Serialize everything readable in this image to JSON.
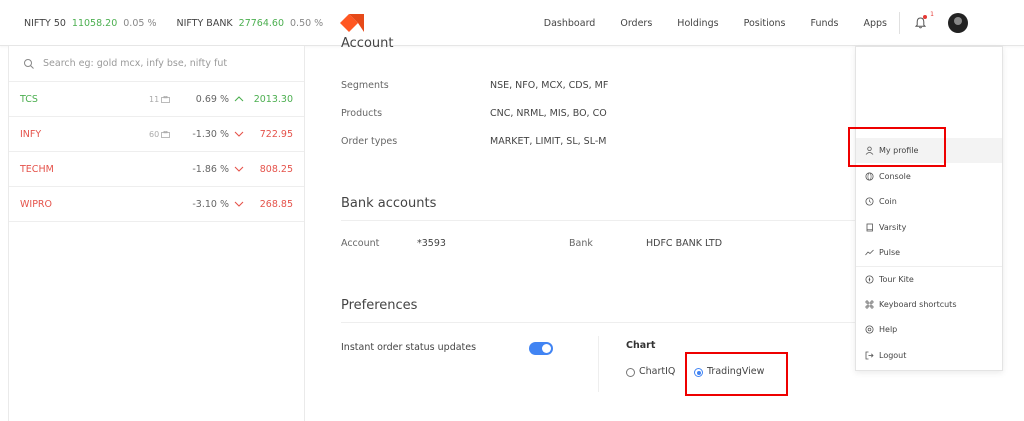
{
  "header": {
    "indices": [
      {
        "name": "NIFTY 50",
        "value": "11058.20",
        "change": "0.05 %"
      },
      {
        "name": "NIFTY BANK",
        "value": "27764.60",
        "change": "0.50 %"
      }
    ],
    "nav": [
      "Dashboard",
      "Orders",
      "Holdings",
      "Positions",
      "Funds",
      "Apps"
    ],
    "notification_count": "1",
    "accent": "#ff5722"
  },
  "sidebar": {
    "search_placeholder": "Search eg: gold mcx, infy bse, nifty fut",
    "watchlist": [
      {
        "symbol": "TCS",
        "qty": "11",
        "change": "0.69 %",
        "price": "2013.30",
        "dir": "up"
      },
      {
        "symbol": "INFY",
        "qty": "60",
        "change": "-1.30 %",
        "price": "722.95",
        "dir": "down"
      },
      {
        "symbol": "TECHM",
        "qty": "",
        "change": "-1.86 %",
        "price": "808.25",
        "dir": "down"
      },
      {
        "symbol": "WIPRO",
        "qty": "",
        "change": "-3.10 %",
        "price": "268.85",
        "dir": "down"
      }
    ]
  },
  "account": {
    "title": "Account",
    "segments_label": "Segments",
    "segments_value": "NSE, NFO, MCX, CDS, MF",
    "products_label": "Products",
    "products_value": "CNC, NRML, MIS, BO, CO",
    "order_types_label": "Order types",
    "order_types_value": "MARKET, LIMIT, SL, SL-M"
  },
  "bank": {
    "title": "Bank accounts",
    "account_label": "Account",
    "account_value": "*3593",
    "bank_label": "Bank",
    "bank_value": "HDFC BANK LTD"
  },
  "preferences": {
    "title": "Preferences",
    "instant_label": "Instant order status updates",
    "chart_label": "Chart",
    "option_chartiq": "ChartIQ",
    "option_tradingview": "TradingView"
  },
  "menu": {
    "items": [
      "My profile",
      "Console",
      "Coin",
      "Varsity",
      "Pulse",
      "Tour Kite",
      "Keyboard shortcuts",
      "Help",
      "Logout"
    ]
  }
}
